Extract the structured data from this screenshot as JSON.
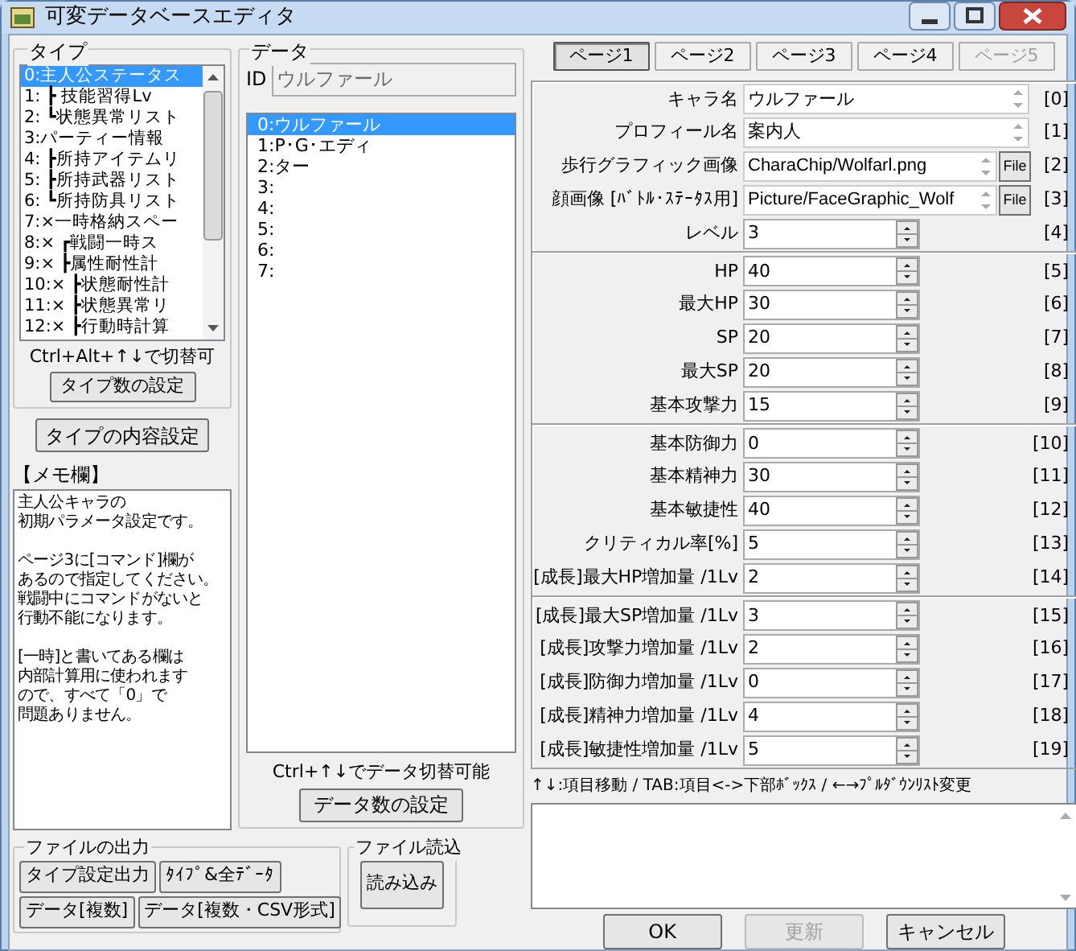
{
  "window": {
    "title": "可変データベースエディタ"
  },
  "type_panel": {
    "title": "タイプ",
    "items": [
      {
        "label": "0:主人公ステータス",
        "selected": true
      },
      {
        "label": "1: ┣ 技能習得Lv",
        "selected": false
      },
      {
        "label": "2: ┗状態異常リスト",
        "selected": false
      },
      {
        "label": "3:パーティー情報",
        "selected": false
      },
      {
        "label": "4: ┣所持アイテムリ",
        "selected": false
      },
      {
        "label": "5: ┣所持武器リスト",
        "selected": false
      },
      {
        "label": "6: ┗所持防具リスト",
        "selected": false
      },
      {
        "label": "7:×一時格納スペー",
        "selected": false
      },
      {
        "label": "8:× ┏戦闘一時ス",
        "selected": false
      },
      {
        "label": "9:× ┣属性耐性計",
        "selected": false
      },
      {
        "label": "10:× ┣状態耐性計",
        "selected": false
      },
      {
        "label": "11:× ┣状態異常リ",
        "selected": false
      },
      {
        "label": "12:× ┣行動時計算",
        "selected": false
      }
    ],
    "hint": "Ctrl+Alt+↑↓で切替可",
    "count_button": "タイプ数の設定"
  },
  "type_content_button": "タイプの内容設定",
  "memo": {
    "label": "【メモ欄】",
    "paragraphs": [
      [
        "主人公キャラの",
        "初期パラメータ設定です。"
      ],
      [
        "ページ3に[コマンド]欄が",
        "あるので指定してください。",
        "戦闘中にコマンドがないと",
        "行動不能になります。"
      ],
      [
        "[一時]と書いてある欄は",
        "内部計算用に使われます",
        "ので、すべて「0」で",
        "問題ありません。"
      ]
    ]
  },
  "file_output": {
    "title": "ファイルの出力",
    "buttons": [
      "タイプ設定出力",
      "ﾀｲﾌﾟ&全ﾃﾞｰﾀ",
      "データ[複数]",
      "データ[複数・CSV形式]"
    ]
  },
  "file_load": {
    "title": "ファイル読込",
    "button": "読み込み"
  },
  "data_panel": {
    "title": "データ",
    "id_label": "ID",
    "id_value": "ウルファール",
    "items": [
      {
        "label": "0:ウルファール",
        "selected": true
      },
      {
        "label": "1:P･G･エディ",
        "selected": false
      },
      {
        "label": "2:ター",
        "selected": false
      },
      {
        "label": "3:",
        "selected": false
      },
      {
        "label": "4:",
        "selected": false
      },
      {
        "label": "5:",
        "selected": false
      },
      {
        "label": "6:",
        "selected": false
      },
      {
        "label": "7:",
        "selected": false
      }
    ],
    "hint": "Ctrl+↑↓でデータ切替可能",
    "count_button": "データ数の設定"
  },
  "tabs": [
    {
      "label": "ページ1",
      "selected": true,
      "disabled": false
    },
    {
      "label": "ページ2",
      "selected": false,
      "disabled": false
    },
    {
      "label": "ページ3",
      "selected": false,
      "disabled": false
    },
    {
      "label": "ページ4",
      "selected": false,
      "disabled": false
    },
    {
      "label": "ページ5",
      "selected": false,
      "disabled": true
    }
  ],
  "field_groups": [
    {
      "fields": [
        {
          "kind": "text",
          "label": "キャラ名",
          "value": "ウルファール",
          "index": "[0]"
        },
        {
          "kind": "text",
          "label": "プロフィール名",
          "value": "案内人",
          "index": "[1]"
        },
        {
          "kind": "file",
          "label": "歩行グラフィック画像",
          "value": "CharaChip/Wolfarl.png",
          "button": "File",
          "index": "[2]"
        },
        {
          "kind": "file",
          "label": "顔画像 [ﾊﾞﾄﾙ･ｽﾃｰﾀｽ用]",
          "value": "Picture/FaceGraphic_Wolf",
          "button": "File",
          "index": "[3]"
        },
        {
          "kind": "number",
          "label": "レベル",
          "value": "3",
          "index": "[4]"
        }
      ]
    },
    {
      "fields": [
        {
          "kind": "number",
          "label": "HP",
          "value": "40",
          "index": "[5]"
        },
        {
          "kind": "number",
          "label": "最大HP",
          "value": "30",
          "index": "[6]"
        },
        {
          "kind": "number",
          "label": "SP",
          "value": "20",
          "index": "[7]"
        },
        {
          "kind": "number",
          "label": "最大SP",
          "value": "20",
          "index": "[8]"
        },
        {
          "kind": "number",
          "label": "基本攻撃力",
          "value": "15",
          "index": "[9]"
        }
      ]
    },
    {
      "fields": [
        {
          "kind": "number",
          "label": "基本防御力",
          "value": "0",
          "index": "[10]"
        },
        {
          "kind": "number",
          "label": "基本精神力",
          "value": "30",
          "index": "[11]"
        },
        {
          "kind": "number",
          "label": "基本敏捷性",
          "value": "40",
          "index": "[12]"
        },
        {
          "kind": "number",
          "label": "クリティカル率[%]",
          "value": "5",
          "index": "[13]"
        },
        {
          "kind": "number",
          "label": "[成長]最大HP増加量 /1Lv",
          "value": "2",
          "index": "[14]"
        }
      ]
    },
    {
      "fields": [
        {
          "kind": "number",
          "label": "[成長]最大SP増加量 /1Lv",
          "value": "3",
          "index": "[15]"
        },
        {
          "kind": "number",
          "label": "[成長]攻撃力増加量 /1Lv",
          "value": "2",
          "index": "[16]"
        },
        {
          "kind": "number",
          "label": "[成長]防御力増加量 /1Lv",
          "value": "0",
          "index": "[17]"
        },
        {
          "kind": "number",
          "label": "[成長]精神力増加量 /1Lv",
          "value": "4",
          "index": "[18]"
        },
        {
          "kind": "number",
          "label": "[成長]敏捷性増加量 /1Lv",
          "value": "5",
          "index": "[19]"
        }
      ]
    }
  ],
  "key_hint": "↑↓:項目移動 / TAB:項目<->下部ﾎﾞｯｸｽ / ←→ﾌﾟﾙﾀﾞｳﾝﾘｽﾄ変更",
  "buttons": [
    {
      "label": "OK",
      "disabled": false
    },
    {
      "label": "更新",
      "disabled": true
    },
    {
      "label": "キャンセル",
      "disabled": false
    }
  ]
}
